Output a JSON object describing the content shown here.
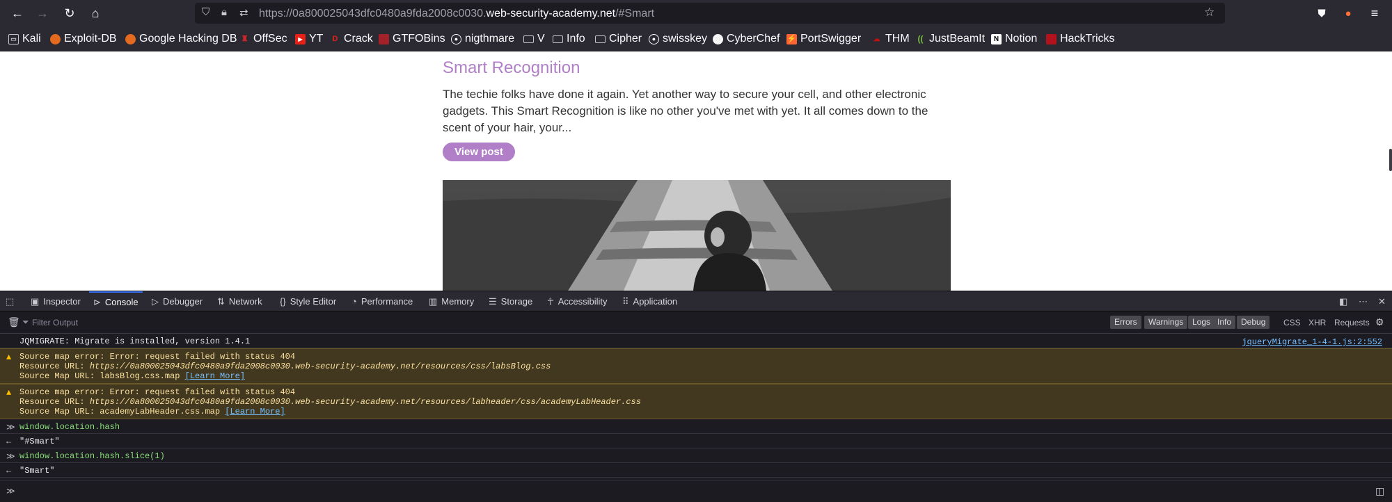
{
  "browser": {
    "url_prefix": "https://0a800025043dfc0480a9fda2008c0030.",
    "url_host": "web-security-academy.net",
    "url_suffix": "/#Smart"
  },
  "bookmarks": [
    "Kali",
    "Exploit-DB",
    "Google Hacking DB",
    "OffSec",
    "YT",
    "Crack",
    "GTFOBins",
    "nigthmare",
    "V",
    "Info",
    "Cipher",
    "swisskey",
    "CyberChef",
    "PortSwigger",
    "THM",
    "JustBeamIt",
    "Notion",
    "HackTricks"
  ],
  "page": {
    "post_title": "Smart Recognition",
    "post_desc": "The techie folks have done it again. Yet another way to secure your cell, and other electronic gadgets. This Smart Recognition is like no other you've met with yet. It all comes down to the scent of your hair, your...",
    "view_post": "View post"
  },
  "devtools": {
    "tabs": [
      "Inspector",
      "Console",
      "Debugger",
      "Network",
      "Style Editor",
      "Performance",
      "Memory",
      "Storage",
      "Accessibility",
      "Application"
    ],
    "filter_placeholder": "Filter Output",
    "filter_buttons": [
      "Errors",
      "Warnings",
      "Logs",
      "Info",
      "Debug"
    ],
    "filter_plain": [
      "CSS",
      "XHR",
      "Requests"
    ]
  },
  "console": {
    "log1": "JQMIGRATE: Migrate is installed, version 1.4.1",
    "log1_src": "jqueryMigrate_1-4-1.js:2:552",
    "warn1_l1": "Source map error: Error: request failed with status 404",
    "warn1_l2_label": "Resource URL: ",
    "warn1_l2_url": "https://0a800025043dfc0480a9fda2008c0030.web-security-academy.net/resources/css/labsBlog.css",
    "warn1_l3_label": "Source Map URL: labsBlog.css.map ",
    "warn2_l1": "Source map error: Error: request failed with status 404",
    "warn2_l2_label": "Resource URL: ",
    "warn2_l2_url": "https://0a800025043dfc0480a9fda2008c0030.web-security-academy.net/resources/labheader/css/academyLabHeader.css",
    "warn2_l3_label": "Source Map URL: academyLabHeader.css.map ",
    "learn_more": "[Learn More]",
    "cmd1": "window.location.hash",
    "res1": "\"#Smart\"",
    "cmd2": "window.location.hash.slice(1)",
    "res2": "\"Smart\""
  }
}
